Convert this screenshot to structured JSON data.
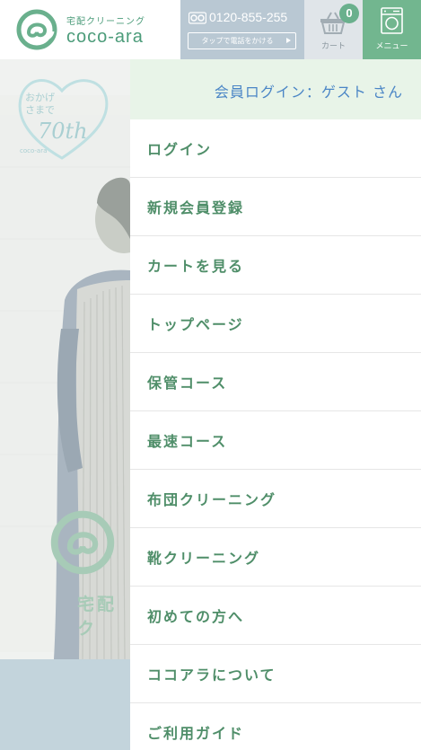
{
  "header": {
    "logo_sub": "宅配クリーニング",
    "logo_name": "coco-ara",
    "tel_number": "0120-855-255",
    "tel_button": "タップで電話をかける",
    "cart_count": "0",
    "cart_label": "カート",
    "menu_label": "メニュー"
  },
  "hero": {
    "anniv_line1": "おかげ",
    "anniv_line2": "さまで",
    "anniv_year": "70th",
    "anniv_brand": "coco-ara",
    "brand_text": "宅配ク"
  },
  "drawer": {
    "login_status": "会員ログイン：ゲスト さん",
    "items": [
      {
        "label": "ログイン"
      },
      {
        "label": "新規会員登録"
      },
      {
        "label": "カートを見る"
      },
      {
        "label": "トップページ"
      },
      {
        "label": "保管コース"
      },
      {
        "label": "最速コース"
      },
      {
        "label": "布団クリーニング"
      },
      {
        "label": "靴クリーニング"
      },
      {
        "label": "初めての方へ"
      },
      {
        "label": "ココアラについて"
      },
      {
        "label": "ご利用ガイド"
      }
    ]
  },
  "colors": {
    "brand_green": "#4c9c7a",
    "menu_green": "#72b68f",
    "tel_bg": "#b9c8d3",
    "drawer_head_bg": "#e8f4e8",
    "login_text": "#4b86c6"
  }
}
